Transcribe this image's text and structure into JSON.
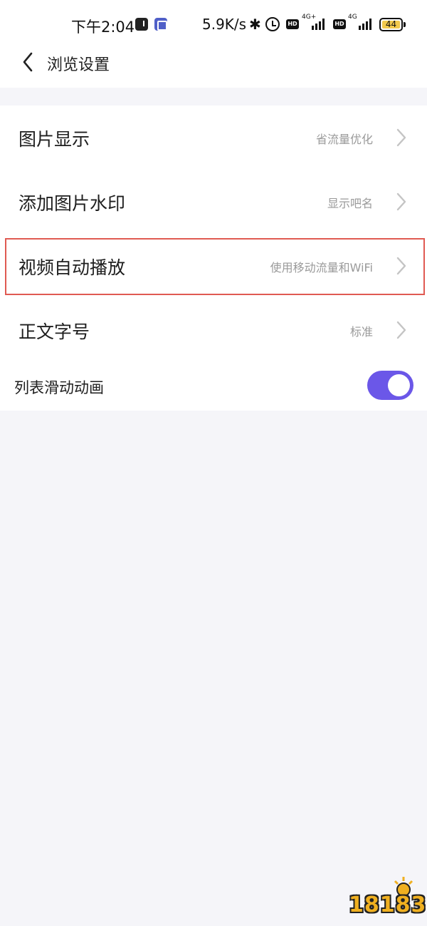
{
  "status_bar": {
    "time": "下午2:04",
    "net_speed": "5.9K/s",
    "hd_label": "HD",
    "net_type_1": "4G+",
    "net_type_2": "4G",
    "battery": "44"
  },
  "header": {
    "title": "浏览设置"
  },
  "settings": [
    {
      "label": "图片显示",
      "value": "省流量优化"
    },
    {
      "label": "添加图片水印",
      "value": "显示吧名"
    },
    {
      "label": "视频自动播放",
      "value": "使用移动流量和WiFi"
    },
    {
      "label": "正文字号",
      "value": "标准"
    }
  ],
  "toggle_setting": {
    "label": "列表滑动动画",
    "enabled": true
  },
  "watermark": {
    "text": "18183"
  },
  "colors": {
    "accent": "#6b57e8",
    "highlight_border": "#e05a52",
    "page_background": "#f5f5f9"
  }
}
